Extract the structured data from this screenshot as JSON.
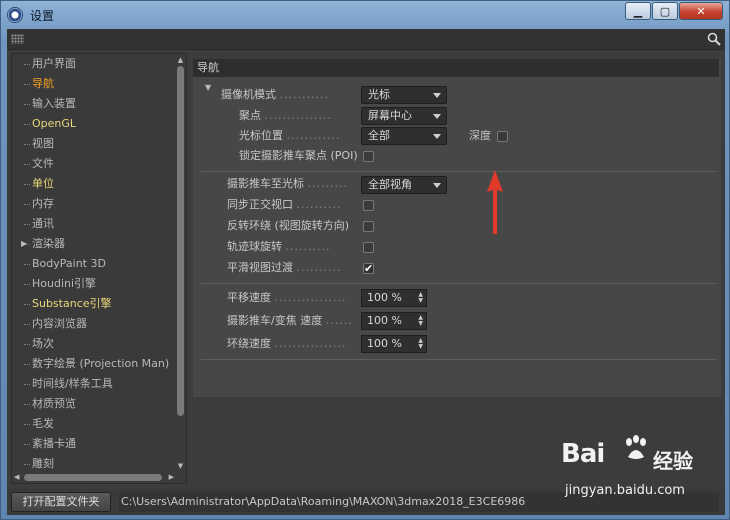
{
  "window": {
    "title": "设置",
    "min_glyph": "▁",
    "max_glyph": "▢",
    "close_glyph": "✕"
  },
  "sidebar": {
    "items": [
      {
        "label": "用户界面",
        "state": "normal"
      },
      {
        "label": "导航",
        "state": "selected"
      },
      {
        "label": "输入装置",
        "state": "normal"
      },
      {
        "label": "OpenGL",
        "state": "highlight"
      },
      {
        "label": "视图",
        "state": "normal"
      },
      {
        "label": "文件",
        "state": "normal"
      },
      {
        "label": "单位",
        "state": "highlight"
      },
      {
        "label": "内存",
        "state": "normal"
      },
      {
        "label": "通讯",
        "state": "normal"
      },
      {
        "label": "渲染器",
        "state": "normal",
        "expandable": true
      },
      {
        "label": "BodyPaint 3D",
        "state": "normal"
      },
      {
        "label": "Houdini引擎",
        "state": "normal"
      },
      {
        "label": "Substance引擎",
        "state": "highlight"
      },
      {
        "label": "内容浏览器",
        "state": "normal"
      },
      {
        "label": "场次",
        "state": "normal"
      },
      {
        "label": "数字绘景 (Projection Man)",
        "state": "normal"
      },
      {
        "label": "时间线/样条工具",
        "state": "normal"
      },
      {
        "label": "材质预览",
        "state": "normal"
      },
      {
        "label": "毛发",
        "state": "normal"
      },
      {
        "label": "紊播卡通",
        "state": "normal"
      },
      {
        "label": "雕刻",
        "state": "normal"
      }
    ]
  },
  "main": {
    "section_title": "导航",
    "camera_mode": {
      "label": "摄像机模式",
      "dots": "...........",
      "value": "光标"
    },
    "pivot": {
      "label": "聚点",
      "dots": "...............",
      "value": "屏幕中心"
    },
    "cursor_pos": {
      "label": "光标位置",
      "dots": "............",
      "value": "全部"
    },
    "depth": {
      "label": "深度",
      "checked": false
    },
    "lock_poi": {
      "label": "锁定摄影推车聚点 (POI)",
      "checked": false
    },
    "dolly_to_cursor": {
      "label": "摄影推车至光标",
      "dots": ".........",
      "value": "全部视角"
    },
    "sync_ortho": {
      "label": "同步正交视口",
      "dots": "..........",
      "checked": false
    },
    "invert_orbit": {
      "label": "反转环绕 (视图旋转方向)",
      "checked": false
    },
    "trackball": {
      "label": "轨迹球旋转",
      "dots": "..........",
      "checked": false
    },
    "smooth_transition": {
      "label": "平滑视图过渡",
      "dots": "..........",
      "checked": true
    },
    "pan_speed": {
      "label": "平移速度",
      "dots": "................",
      "value": "100 %"
    },
    "dolly_speed": {
      "label": "摄影推车/变焦 速度",
      "dots": "......",
      "value": "100 %"
    },
    "orbit_speed": {
      "label": "环绕速度",
      "dots": "................",
      "value": "100 %"
    }
  },
  "bottom": {
    "open_button": "打开配置文件夹",
    "path": "C:\\Users\\Administrator\\AppData\\Roaming\\MAXON\\3dmax2018_E3CE6986"
  },
  "watermark": {
    "logo": "Bai",
    "cn": "经验",
    "url": "jingyan.baidu.com"
  },
  "colors": {
    "selected": "#f0a020",
    "highlight": "#e9d77a",
    "annotation_arrow": "#e23a2a"
  }
}
